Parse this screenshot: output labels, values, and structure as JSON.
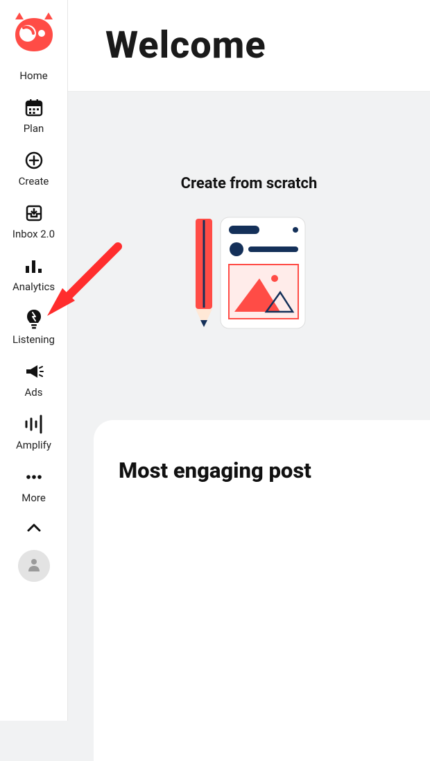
{
  "colors": {
    "brand": "#FF4C46",
    "dark": "#143059"
  },
  "header": {
    "title": "Welcome"
  },
  "sidebar": {
    "items": [
      {
        "label": "Home"
      },
      {
        "label": "Plan"
      },
      {
        "label": "Create"
      },
      {
        "label": "Inbox 2.0"
      },
      {
        "label": "Analytics"
      },
      {
        "label": "Listening"
      },
      {
        "label": "Ads"
      },
      {
        "label": "Amplify"
      },
      {
        "label": "More"
      }
    ]
  },
  "main": {
    "create_heading": "Create from scratch",
    "section_heading": "Most engaging post"
  }
}
